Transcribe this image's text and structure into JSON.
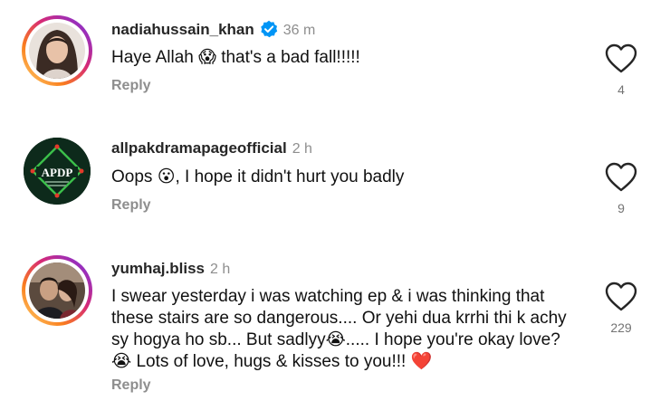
{
  "comments": [
    {
      "username": "nadiahussain_khan",
      "verified": true,
      "time": "36 m",
      "text": "Haye Allah 😱 that's a bad fall!!!!!",
      "reply_label": "Reply",
      "likes": "4",
      "avatar": "woman-portrait-avatar"
    },
    {
      "username": "allpakdramapageofficial",
      "verified": false,
      "time": "2 h",
      "text": "Oops 😮, I hope it didn't hurt you badly",
      "reply_label": "Reply",
      "likes": "9",
      "avatar": "apdp-logo-avatar",
      "avatar_text": "APDP"
    },
    {
      "username": "yumhaj.bliss",
      "verified": false,
      "time": "2 h",
      "text_lines": [
        "I swear yesterday i was watching ep & i was thinking that",
        "these stairs are so dangerous.... Or yehi dua krrhi thi k achy",
        "sy hogya ho sb... But sadlyy😭..... I hope you're okay love?",
        "😭 Lots of love, hugs & kisses to you!!! ❤️"
      ],
      "reply_label": "Reply",
      "likes": "229",
      "avatar": "couple-photo-avatar"
    }
  ],
  "colors": {
    "username": "#262626",
    "secondary": "#8e8e8e",
    "verified_badge": "#0095f6",
    "story_ring": [
      "#feda75",
      "#fa7e1e",
      "#d62976",
      "#962fbf",
      "#4f5bd5"
    ]
  }
}
